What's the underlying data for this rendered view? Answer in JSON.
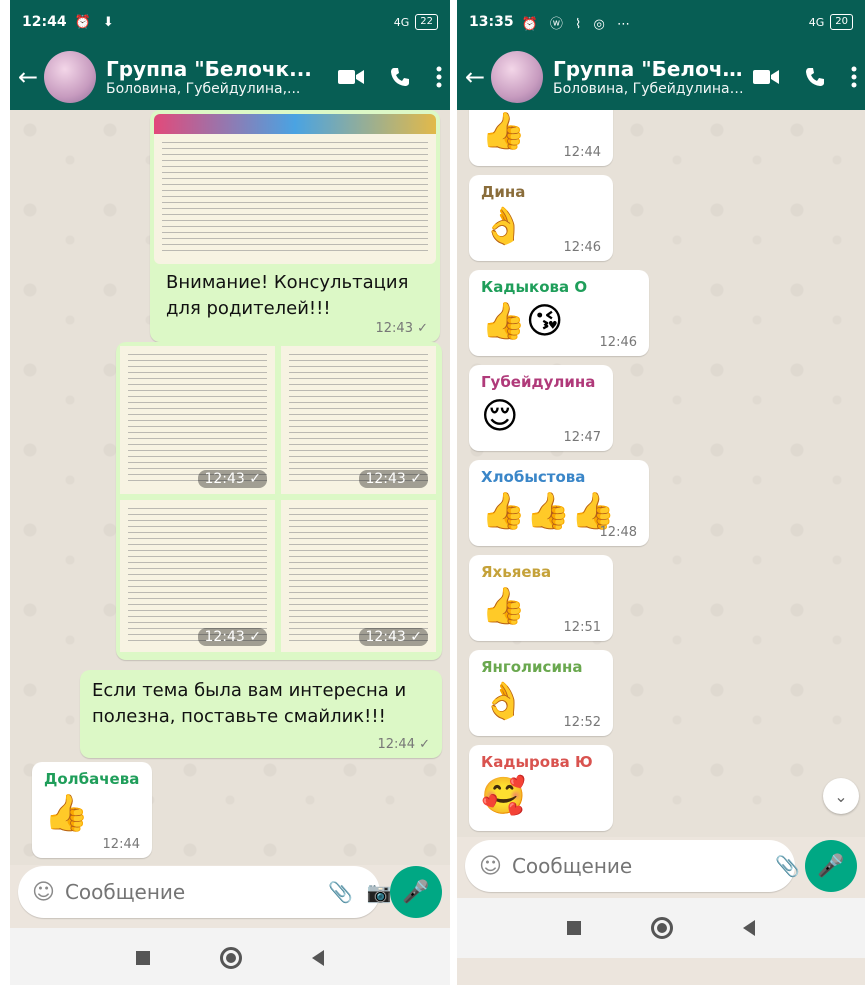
{
  "left": {
    "status": {
      "time": "12:44",
      "icons": "⏰ ⬇",
      "signal": "4G",
      "battery": "22"
    },
    "header": {
      "title": "Группа \"Белочк...",
      "subtitle": "Боловина, Губейдулина,..."
    },
    "messages": {
      "consult_text": "Внимание! Консультация для родителей!!!",
      "consult_time": "12:43 ✓",
      "doc_times": [
        "12:43 ✓",
        "12:43 ✓",
        "12:43 ✓",
        "12:43 ✓"
      ],
      "prompt_text": "Если тема была вам интересна и полезна, поставьте смайлик!!!",
      "prompt_time": "12:44 ✓",
      "last": {
        "sender": "Долбачева",
        "emoji": "👍",
        "time": "12:44"
      }
    },
    "input": {
      "placeholder": "Сообщение"
    }
  },
  "right": {
    "status": {
      "time": "13:35",
      "icons": "⏰ ⓦ ⌇ ◎ ⋯",
      "signal": "4G",
      "battery": "20"
    },
    "header": {
      "title": "Группа \"Белочк...",
      "subtitle": "Боловина, Губейдулина,..."
    },
    "messages": [
      {
        "sender": "Долбачева",
        "emoji": "👍",
        "time": "12:44",
        "color": "#c0504d"
      },
      {
        "sender": "Дина",
        "emoji": "👌",
        "time": "12:46",
        "color": "#8a6d3b"
      },
      {
        "sender": "Кадыкова О",
        "emoji": "👍😘",
        "time": "12:46",
        "color": "#1f9e5a"
      },
      {
        "sender": "Губейдулина",
        "emoji": "😌",
        "time": "12:47",
        "color": "#b03a7a"
      },
      {
        "sender": "Хлобыстова",
        "emoji": "👍👍👍",
        "time": "12:48",
        "color": "#3a86c8"
      },
      {
        "sender": "Яхьяева",
        "emoji": "👍",
        "time": "12:51",
        "color": "#c5a23a"
      },
      {
        "sender": "Янголисина",
        "emoji": "👌",
        "time": "12:52",
        "color": "#6aa84f"
      },
      {
        "sender": "Кадырова Ю",
        "emoji": "🥰",
        "time": "",
        "color": "#d9534f"
      }
    ],
    "input": {
      "placeholder": "Сообщение"
    }
  },
  "colors": {
    "header": "#075e54",
    "accent": "#00a884",
    "outgoing": "#dcf8c6",
    "incoming": "#ffffff"
  }
}
